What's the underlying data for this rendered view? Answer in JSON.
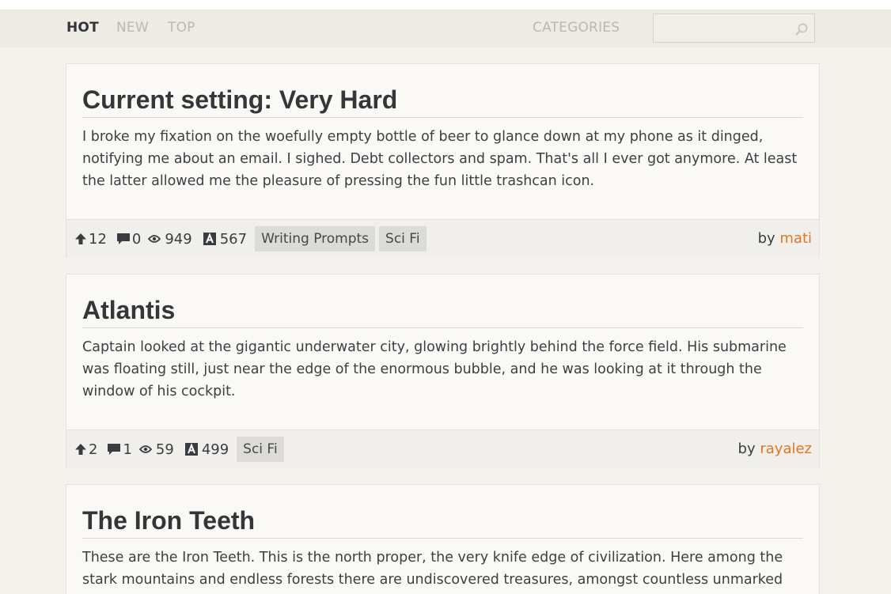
{
  "nav": {
    "hot": "HOT",
    "new": "NEW",
    "top": "TOP",
    "categories": "CATEGORIES",
    "search_placeholder": ""
  },
  "colors": {
    "accent": "#e8741f",
    "background": "#f4f2ec",
    "card": "#faf9f6",
    "footer": "#f0efec",
    "tag": "#dcdbd8"
  },
  "posts": [
    {
      "title": "Current setting: Very Hard",
      "excerpt": "I broke my fixation on the woefully empty bottle of beer to glance down at my phone as it dinged, notifying me about an email. I sighed. Debt collectors and spam. That's all I ever got anymore. At least the latter allowed me the pleasure of pressing the fun little trashcan icon.",
      "upvotes": "12",
      "comments": "0",
      "views": "949",
      "words": "567",
      "tags": [
        "Writing Prompts",
        "Sci Fi"
      ],
      "by": "by",
      "author": "mati"
    },
    {
      "title": "Atlantis",
      "excerpt": "Captain looked at the gigantic underwater city, glowing brightly behind the force field. His submarine was floating still, just near the edge of the enormous bubble, and he was looking at it through the window of his cockpit.",
      "upvotes": "2",
      "comments": "1",
      "views": "59",
      "words": "499",
      "tags": [
        "Sci Fi"
      ],
      "by": "by",
      "author": "rayalez"
    },
    {
      "title": "The Iron Teeth",
      "excerpt": "These are the Iron Teeth. This is the north proper, the very knife edge of civilization. Here among the stark mountains and endless forests there are undiscovered treasures, amongst countless unmarked"
    }
  ]
}
